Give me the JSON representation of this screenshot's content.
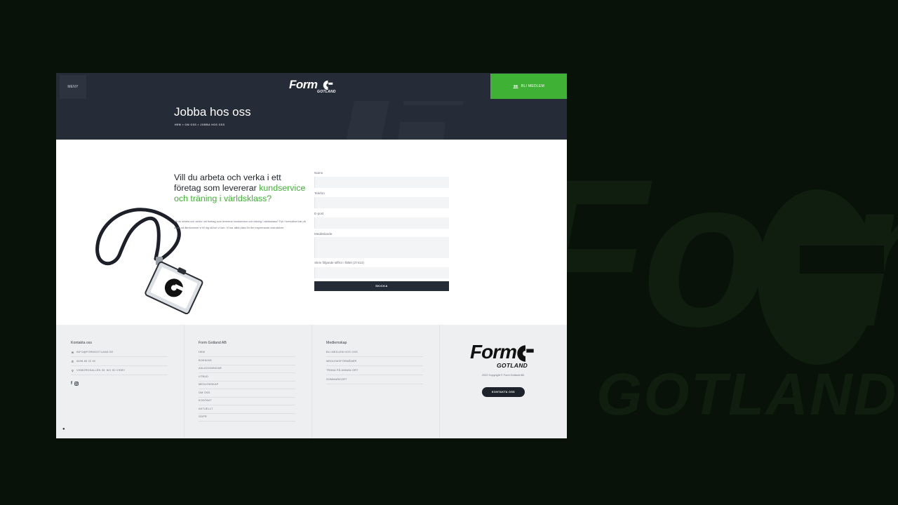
{
  "header": {
    "menu_label": "MENY",
    "logo_text": "Form",
    "logo_sub": "GOTLAND",
    "join_label": "BLI MEDLEM",
    "title": "Jobba hos oss",
    "breadcrumb": "HEM » OM OSS » JOBBA HOS OSS"
  },
  "main": {
    "headline_1": "Vill du arbeta och verka i ett företag som levererar",
    "headline_2": "kundservice och träning i världsklass?",
    "intro": "Vill du arbeta och verka i ett företag som levererar kundservice och träning i världsklass? Fyll i formuläret här på sidan så återkommer vi till dig så fort vi kan. Vi har alltid plats för fler inspirerande instruktörer."
  },
  "form": {
    "name_label": "Namn",
    "phone_label": "Telefon",
    "email_label": "E-post",
    "message_label": "Meddelande",
    "captcha_label": "Skriv följande siffror i fältet (27413)",
    "submit_label": "SKICKA"
  },
  "footer": {
    "contact": {
      "heading": "Kontakta oss",
      "email": "INFO@FORMGOTLAND.SE",
      "phone": "0498-65 22 40",
      "address": "VISBORGSALLÉN 33, 621 50 VISBY"
    },
    "company": {
      "heading": "Form Gotland AB",
      "links": [
        "HEM",
        "BOKNING",
        "ANLÄGGNINGAR",
        "UTBUD",
        "MEDLEMSKAP",
        "OM OSS",
        "KONTAKT",
        "AKTUELLT",
        "GDPR"
      ]
    },
    "membership": {
      "heading": "Medlemskap",
      "links": [
        "BLI MEDLEM HOS OSS",
        "MEDLEMSFÖRMÅNER",
        "TRÄNA PÅ ANNAN ORT",
        "SOMMARKORT"
      ]
    },
    "logo_text": "Form",
    "logo_sub": "GOTLAND",
    "copyright": "2022 Copyright © Form Gotland AB",
    "contact_button": "KONTAKTA OSS"
  },
  "colors": {
    "accent": "#3fb134",
    "header_bg": "#262c37",
    "outer_bg": "#081208",
    "footer_bg": "#eeeff1"
  }
}
